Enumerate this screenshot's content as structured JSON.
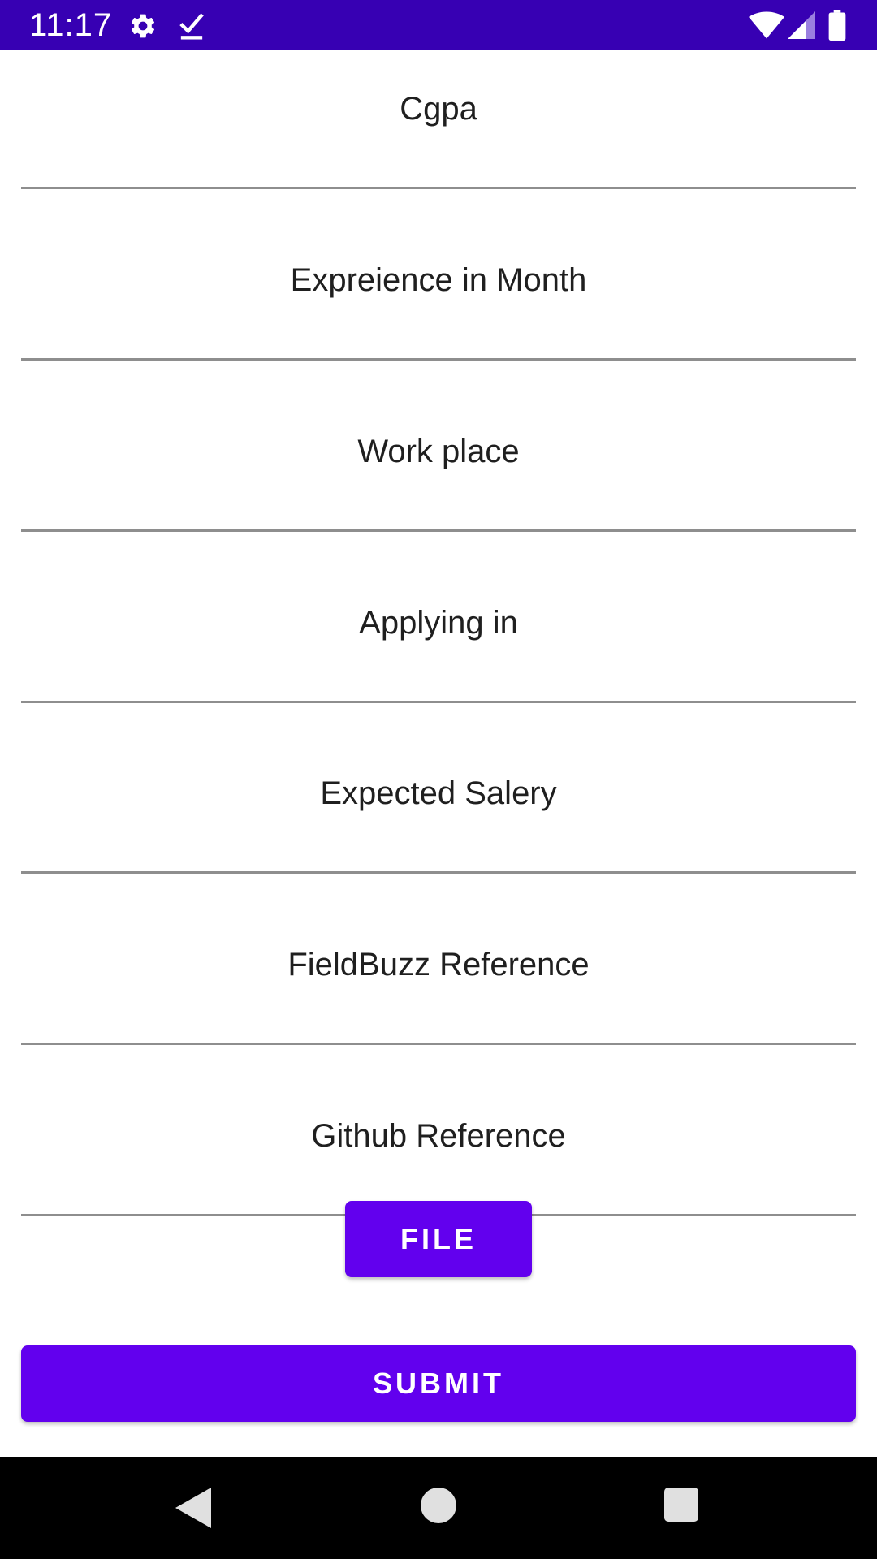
{
  "status_bar": {
    "time": "11:17",
    "background_color": "#3700b3",
    "icons": [
      "gear-icon",
      "check-download-icon",
      "wifi-icon",
      "signal-icon",
      "battery-icon"
    ]
  },
  "form": {
    "fields": [
      {
        "hint": "Cgpa"
      },
      {
        "hint": "Expreience in Month"
      },
      {
        "hint": "Work place"
      },
      {
        "hint": "Applying in"
      },
      {
        "hint": "Expected Salery"
      },
      {
        "hint": "FieldBuzz Reference"
      },
      {
        "hint": "Github Reference"
      }
    ],
    "file_button_label": "FILE",
    "submit_button_label": "SUBMIT",
    "accent_color": "#6200ee"
  },
  "nav_bar": {
    "icons": [
      "back-icon",
      "home-icon",
      "recents-icon"
    ]
  }
}
